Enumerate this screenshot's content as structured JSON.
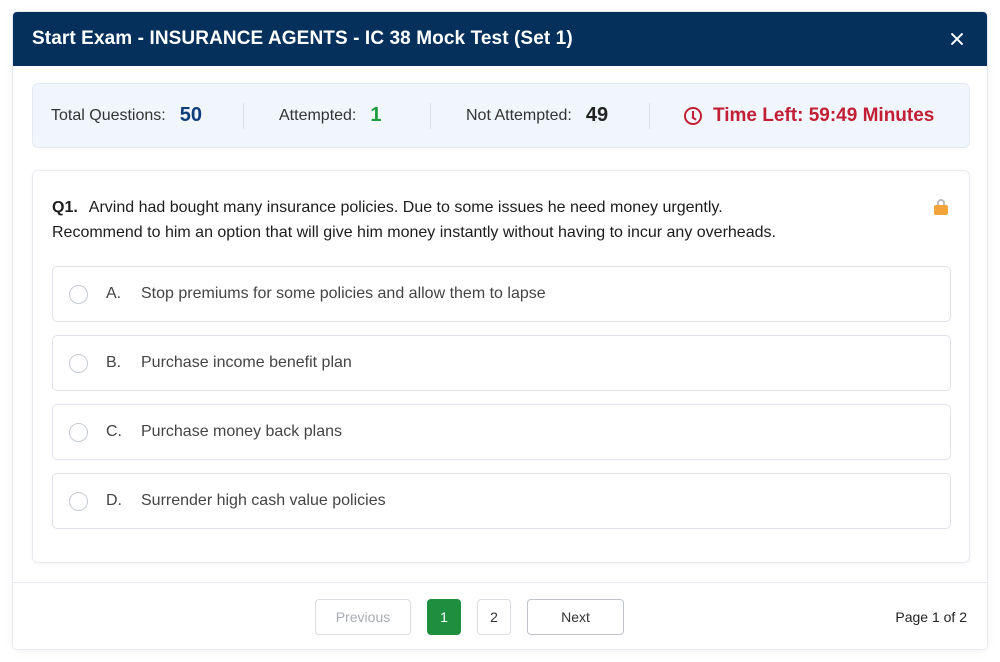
{
  "modal": {
    "title": "Start Exam - INSURANCE AGENTS - IC 38 Mock Test (Set 1)"
  },
  "stats": {
    "total_label": "Total Questions:",
    "total_value": "50",
    "attempted_label": "Attempted:",
    "attempted_value": "1",
    "not_attempted_label": "Not Attempted:",
    "not_attempted_value": "49",
    "timer_text": "Time Left: 59:49 Minutes"
  },
  "question": {
    "number": "Q1.",
    "line1": "Arvind had bought many insurance policies. Due to some issues he need money urgently.",
    "line2": "Recommend to him an option that will give him money instantly without having to incur any overheads.",
    "options": [
      {
        "letter": "A.",
        "text": "Stop premiums for some policies and allow them to lapse"
      },
      {
        "letter": "B.",
        "text": "Purchase income benefit plan"
      },
      {
        "letter": "C.",
        "text": "Purchase money back plans"
      },
      {
        "letter": "D.",
        "text": "Surrender high cash value policies"
      }
    ]
  },
  "pagination": {
    "previous_label": "Previous",
    "page1_label": "1",
    "page2_label": "2",
    "next_label": "Next",
    "page_info": "Page 1 of 2"
  },
  "colors": {
    "header_bg": "#06305c",
    "attempted": "#1f9d3a",
    "timer": "#c21f34",
    "active_page": "#1e8f3e"
  },
  "icons": {
    "close": "close-icon",
    "timer": "clock-icon",
    "lock": "lock-icon"
  }
}
